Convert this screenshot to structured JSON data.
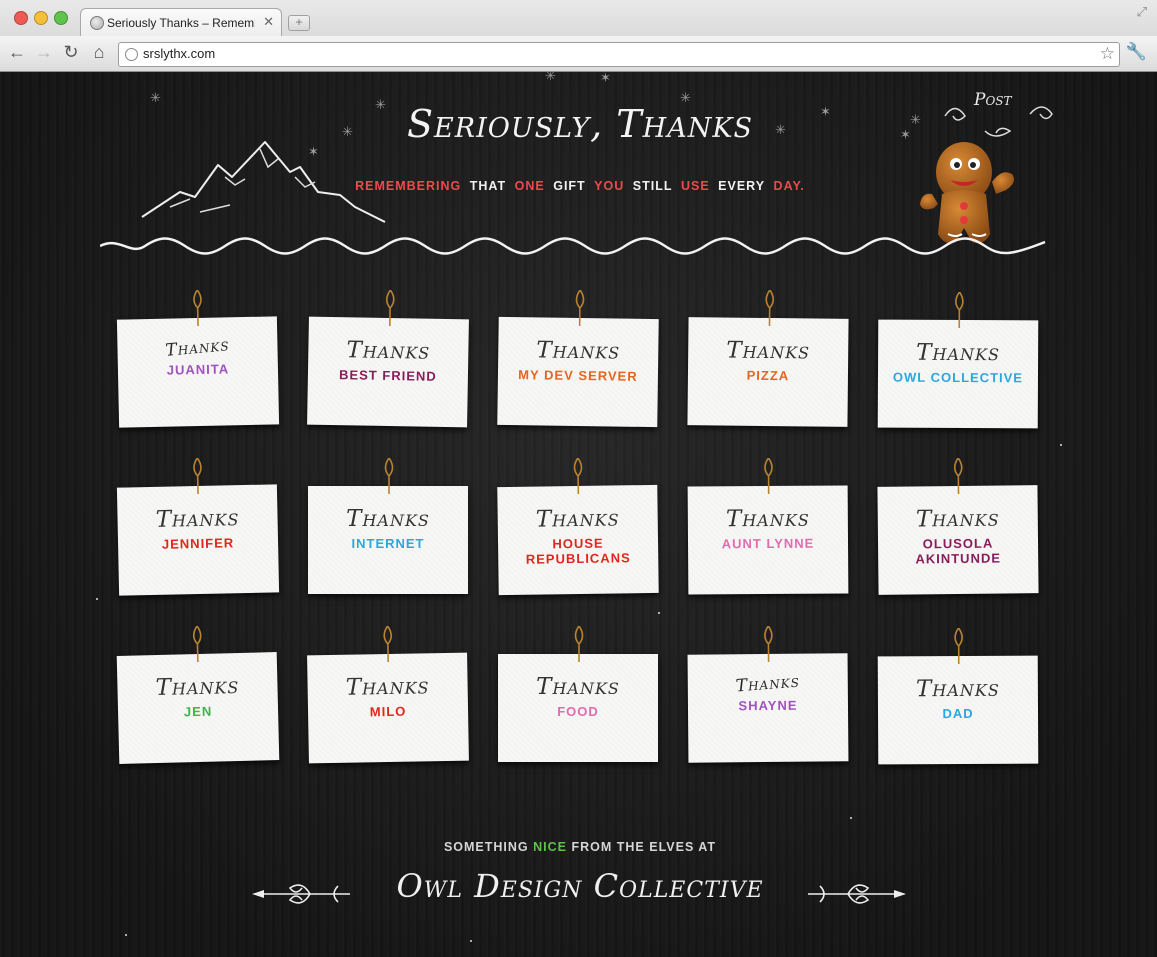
{
  "browser": {
    "tab_title": "Seriously Thanks – Rememb",
    "url": "srslythx.com"
  },
  "header": {
    "title": "Seriously, Thanks",
    "tagline": [
      {
        "text": "REMEMBERING",
        "color": "#ec4b4b"
      },
      {
        "text": "THAT",
        "color": "#f2f2f2"
      },
      {
        "text": "ONE",
        "color": "#ec4b4b"
      },
      {
        "text": "GIFT",
        "color": "#f2f2f2"
      },
      {
        "text": "YOU",
        "color": "#ec4b4b"
      },
      {
        "text": "STILL",
        "color": "#f2f2f2"
      },
      {
        "text": "USE",
        "color": "#ec4b4b"
      },
      {
        "text": "EVERY",
        "color": "#f2f2f2"
      },
      {
        "text": "DAY.",
        "color": "#ec4b4b"
      }
    ],
    "post_link": "Post"
  },
  "cards": [
    {
      "thanks": "Thanks",
      "name": "JUANITA",
      "color": "#a052c0",
      "sig": true
    },
    {
      "thanks": "Thanks",
      "name": "BEST FRIEND",
      "color": "#8a1c5c",
      "sig": false
    },
    {
      "thanks": "Thanks",
      "name": "MY DEV SERVER",
      "color": "#e8631c",
      "sig": false
    },
    {
      "thanks": "Thanks",
      "name": "PIZZA",
      "color": "#e8631c",
      "sig": false
    },
    {
      "thanks": "Thanks",
      "name": "OWL COLLECTIVE",
      "color": "#2aa7e0",
      "sig": false
    },
    {
      "thanks": "Thanks",
      "name": "JENNIFER",
      "color": "#e0261d",
      "sig": false
    },
    {
      "thanks": "Thanks",
      "name": "INTERNET",
      "color": "#2aa7e0",
      "sig": false
    },
    {
      "thanks": "Thanks",
      "name": "HOUSE REPUBLICANS",
      "color": "#e0261d",
      "sig": false
    },
    {
      "thanks": "Thanks",
      "name": "AUNT LYNNE",
      "color": "#e06cb0",
      "sig": false
    },
    {
      "thanks": "Thanks",
      "name": "OLUSOLA AKINTUNDE",
      "color": "#8a1c5c",
      "sig": false
    },
    {
      "thanks": "Thanks",
      "name": "JEN",
      "color": "#3cb548",
      "sig": false
    },
    {
      "thanks": "Thanks",
      "name": "MILO",
      "color": "#e0261d",
      "sig": false
    },
    {
      "thanks": "Thanks",
      "name": "FOOD",
      "color": "#e06cb0",
      "sig": false
    },
    {
      "thanks": "Thanks",
      "name": "SHAYNE",
      "color": "#a052c0",
      "sig": true
    },
    {
      "thanks": "Thanks",
      "name": "DAD",
      "color": "#2aa7e0",
      "sig": false
    }
  ],
  "footer": {
    "line_part1": "SOMETHING",
    "line_highlight": "NICE",
    "line_part2": "FROM THE ELVES AT",
    "brand": "Owl Design Collective"
  }
}
